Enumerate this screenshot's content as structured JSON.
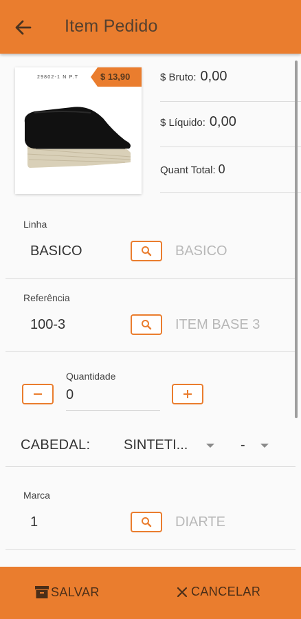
{
  "appbar": {
    "title": "Item Pedido",
    "back_icon": "arrow-left-icon"
  },
  "product": {
    "code": "29802-1 N P.T",
    "price": "$ 13,90"
  },
  "summary": {
    "bruto_label": "$ Bruto:",
    "bruto_value": "0,00",
    "liquido_label": "$ Líquido:",
    "liquido_value": "0,00",
    "quant_label": "Quant Total:",
    "quant_value": "0"
  },
  "linha": {
    "label": "Linha",
    "value": "BASICO",
    "description": "BASICO"
  },
  "referencia": {
    "label": "Referência",
    "value": "100-3",
    "description": "ITEM BASE 3"
  },
  "quantidade": {
    "label": "Quantidade",
    "value": "0"
  },
  "cabedal": {
    "label": "CABEDAL:",
    "material": "SINTETI...",
    "option": "-"
  },
  "marca": {
    "label": "Marca",
    "value": "1",
    "description": "DIARTE"
  },
  "bottom": {
    "save_label": "SALVAR",
    "cancel_label": "CANCELAR"
  },
  "colors": {
    "accent": "#ea7d2e",
    "title_text": "#55402e"
  }
}
